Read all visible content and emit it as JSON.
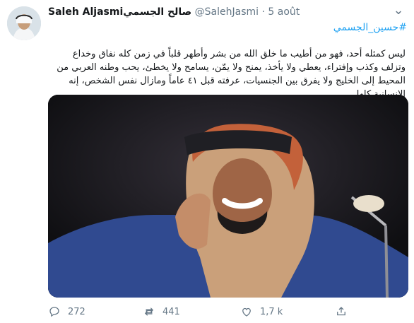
{
  "tweet": {
    "author_name": "Saleh Aljasmi",
    "author_name_ar": "صالح الجسمي",
    "handle": "@SalehJasmi",
    "separator": "·",
    "date": "5 août",
    "hashtag": "#حسين_الجسمي",
    "text": "ليس كمثله أحد، فهو من أطيب ما خلق الله من بشر وأطهر قلباً في زمن كله نفاق وخداع وتزلف وكذب وإفتراء، يعطي ولا يأخذ، يمنح ولا يمّن، يسامح ولا يخطئ، يحب وطنه العربي من المحيط إلى الخليج ولا يفرق بين الجنسيات، عرفته قبل ٤١ عاماً ومازال نفس الشخص، إنه الإنسانية كلها."
  },
  "actions": {
    "replies": "272",
    "retweets": "441",
    "likes": "1,7 k"
  },
  "colors": {
    "link": "#1da1f2",
    "muted": "#657786",
    "text": "#14171a"
  },
  "icons": [
    "caret-down-icon",
    "reply-icon",
    "retweet-icon",
    "like-icon",
    "share-icon"
  ]
}
